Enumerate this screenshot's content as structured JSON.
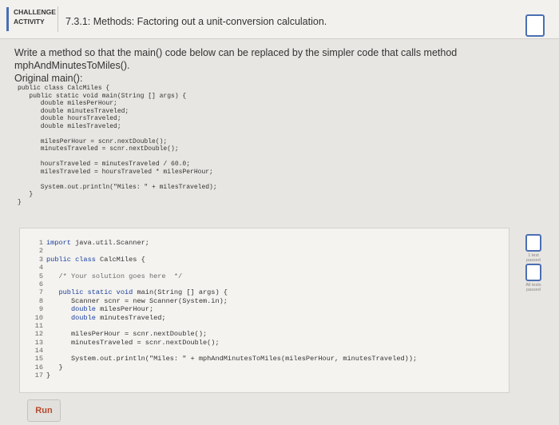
{
  "header": {
    "badge_line1": "CHALLENGE",
    "badge_line2": "ACTIVITY",
    "title": "7.3.1: Methods: Factoring out a unit-conversion calculation."
  },
  "prompt": {
    "line1": "Write a method so that the main() code below can be replaced by the simpler code that calls method mphAndMinutesToMiles().",
    "line2": "Original main():"
  },
  "original_code": "public class CalcMiles {\n   public static void main(String [] args) {\n      double milesPerHour;\n      double minutesTraveled;\n      double hoursTraveled;\n      double milesTraveled;\n\n      milesPerHour = scnr.nextDouble();\n      minutesTraveled = scnr.nextDouble();\n\n      hoursTraveled = minutesTraveled / 60.0;\n      milesTraveled = hoursTraveled * milesPerHour;\n\n      System.out.println(\"Miles: \" + milesTraveled);\n   }\n}",
  "editor_lines": [
    {
      "n": "1",
      "pre": "",
      "kw": "import",
      "text": " java.util.Scanner;"
    },
    {
      "n": "2",
      "pre": "",
      "kw": "",
      "text": ""
    },
    {
      "n": "3",
      "pre": "",
      "kw": "public class",
      "text": " CalcMiles {"
    },
    {
      "n": "4",
      "pre": "",
      "kw": "",
      "text": ""
    },
    {
      "n": "5",
      "pre": "   ",
      "kw": "",
      "text": "",
      "comment": "/* Your solution goes here  */"
    },
    {
      "n": "6",
      "pre": "",
      "kw": "",
      "text": ""
    },
    {
      "n": "7",
      "pre": "   ",
      "kw": "public static void",
      "text": " main(String [] args) {"
    },
    {
      "n": "8",
      "pre": "      ",
      "kw": "",
      "text": "Scanner scnr = new Scanner(System.in);"
    },
    {
      "n": "9",
      "pre": "      ",
      "kw": "double",
      "text": " milesPerHour;"
    },
    {
      "n": "10",
      "pre": "      ",
      "kw": "double",
      "text": " minutesTraveled;"
    },
    {
      "n": "11",
      "pre": "",
      "kw": "",
      "text": ""
    },
    {
      "n": "12",
      "pre": "      ",
      "kw": "",
      "text": "milesPerHour = scnr.nextDouble();"
    },
    {
      "n": "13",
      "pre": "      ",
      "kw": "",
      "text": "minutesTraveled = scnr.nextDouble();"
    },
    {
      "n": "14",
      "pre": "",
      "kw": "",
      "text": ""
    },
    {
      "n": "15",
      "pre": "      ",
      "kw": "",
      "text": "System.out.println(\"Miles: \" + mphAndMinutesToMiles(milesPerHour, minutesTraveled));"
    },
    {
      "n": "16",
      "pre": "   ",
      "kw": "",
      "text": "}"
    },
    {
      "n": "17",
      "pre": "",
      "kw": "",
      "text": "}"
    }
  ],
  "run_label": "Run",
  "tests": [
    {
      "line1": "1 test",
      "line2": "passed"
    },
    {
      "line1": "All tests",
      "line2": "passed"
    }
  ]
}
